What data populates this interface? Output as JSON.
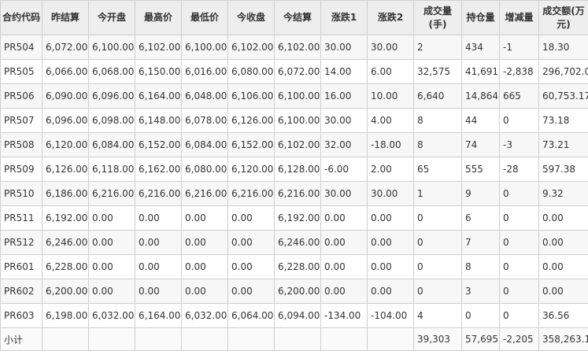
{
  "table": {
    "headers": [
      "合约代码",
      "昨结算",
      "今开盘",
      "最高价",
      "最低价",
      "今收盘",
      "今结算",
      "涨跌1",
      "涨跌2",
      "成交量(手)",
      "持仓量",
      "增减量",
      "成交额(万元)"
    ],
    "rows": [
      [
        "PR504",
        "6,072.00",
        "6,100.00",
        "6,102.00",
        "6,100.00",
        "6,102.00",
        "6,102.00",
        "30.00",
        "30.00",
        "2",
        "434",
        "-1",
        "18.30"
      ],
      [
        "PR505",
        "6,066.00",
        "6,068.00",
        "6,150.00",
        "6,016.00",
        "6,080.00",
        "6,072.00",
        "14.00",
        "6.00",
        "32,575",
        "41,691",
        "-2,838",
        "296,702.03"
      ],
      [
        "PR506",
        "6,090.00",
        "6,096.00",
        "6,164.00",
        "6,048.00",
        "6,106.00",
        "6,100.00",
        "16.00",
        "10.00",
        "6,640",
        "14,864",
        "665",
        "60,753.17"
      ],
      [
        "PR507",
        "6,096.00",
        "6,098.00",
        "6,148.00",
        "6,078.00",
        "6,126.00",
        "6,100.00",
        "30.00",
        "4.00",
        "8",
        "44",
        "0",
        "73.18"
      ],
      [
        "PR508",
        "6,120.00",
        "6,084.00",
        "6,152.00",
        "6,084.00",
        "6,152.00",
        "6,102.00",
        "32.00",
        "-18.00",
        "8",
        "74",
        "-3",
        "73.21"
      ],
      [
        "PR509",
        "6,126.00",
        "6,118.00",
        "6,162.00",
        "6,080.00",
        "6,120.00",
        "6,128.00",
        "-6.00",
        "2.00",
        "65",
        "555",
        "-28",
        "597.38"
      ],
      [
        "PR510",
        "6,186.00",
        "6,216.00",
        "6,216.00",
        "6,216.00",
        "6,216.00",
        "6,216.00",
        "30.00",
        "30.00",
        "1",
        "9",
        "0",
        "9.32"
      ],
      [
        "PR511",
        "6,192.00",
        "0.00",
        "0.00",
        "0.00",
        "0.00",
        "6,192.00",
        "0.00",
        "0.00",
        "0",
        "6",
        "0",
        "0.00"
      ],
      [
        "PR512",
        "6,246.00",
        "0.00",
        "0.00",
        "0.00",
        "0.00",
        "6,246.00",
        "0.00",
        "0.00",
        "0",
        "7",
        "0",
        "0.00"
      ],
      [
        "PR601",
        "6,228.00",
        "0.00",
        "0.00",
        "0.00",
        "0.00",
        "6,228.00",
        "0.00",
        "0.00",
        "0",
        "8",
        "0",
        "0.00"
      ],
      [
        "PR602",
        "6,200.00",
        "0.00",
        "0.00",
        "0.00",
        "0.00",
        "6,200.00",
        "0.00",
        "0.00",
        "0",
        "3",
        "0",
        "0.00"
      ],
      [
        "PR603",
        "6,198.00",
        "6,032.00",
        "6,164.00",
        "6,032.00",
        "6,064.00",
        "6,094.00",
        "-134.00",
        "-104.00",
        "4",
        "0",
        "0",
        "36.56"
      ]
    ],
    "subtotal": [
      "小计",
      "",
      "",
      "",
      "",
      "",
      "",
      "",
      "",
      "39,303",
      "57,695",
      "-2,205",
      "358,263.16"
    ]
  }
}
